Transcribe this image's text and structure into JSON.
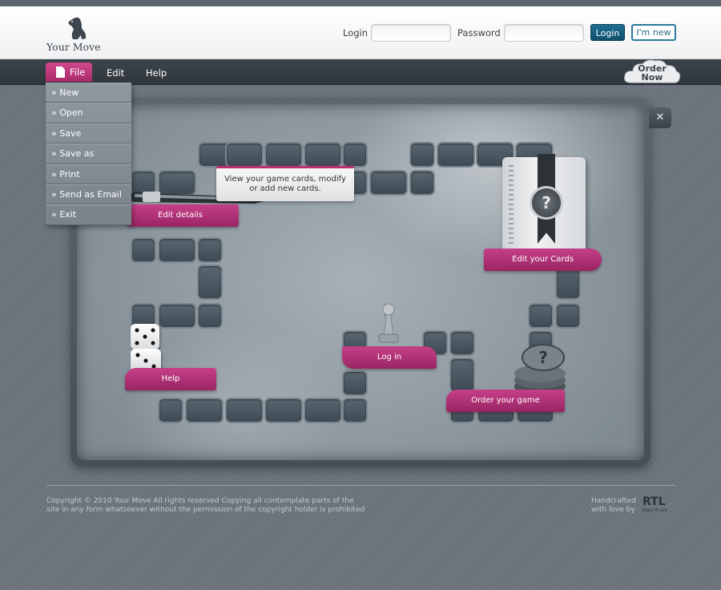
{
  "brand": {
    "name": "Your Move"
  },
  "header": {
    "login_label": "Login",
    "password_label": "Password",
    "login_value": "",
    "password_value": "",
    "login_button": "Login",
    "new_button": "I'm new"
  },
  "menubar": {
    "file": "File",
    "edit": "Edit",
    "help": "Help",
    "order_line1": "Order",
    "order_line2": "Now"
  },
  "file_menu": {
    "items": [
      "» New",
      "» Open",
      "» Save",
      "» Save as",
      "» Print",
      "» Send as Email",
      "» Exit"
    ]
  },
  "board": {
    "close_icon": "✕",
    "edit_details": "Edit details",
    "tooltip_line1": "View your game cards, modify",
    "tooltip_line2": "or add new cards.",
    "edit_cards": "Edit your Cards",
    "help": "Help",
    "log_in": "Log in",
    "order_game": "Order your game",
    "card_symbol": "?"
  },
  "footer": {
    "copyright_line1": "Copyright © 2010 Your Move All rights reserved Copying all contemplate parts of the",
    "copyright_line2": "site in any form whatsoever without the permission of the copyright holder is prohibited",
    "handcrafted_line1": "Handcrafted",
    "handcrafted_line2": "with love by",
    "studio": "RTL",
    "studio_sub": "Right To Left"
  },
  "colors": {
    "accent": "#b8306f",
    "primary_button": "#0f4e6b",
    "header_bar": "#2f363c"
  }
}
